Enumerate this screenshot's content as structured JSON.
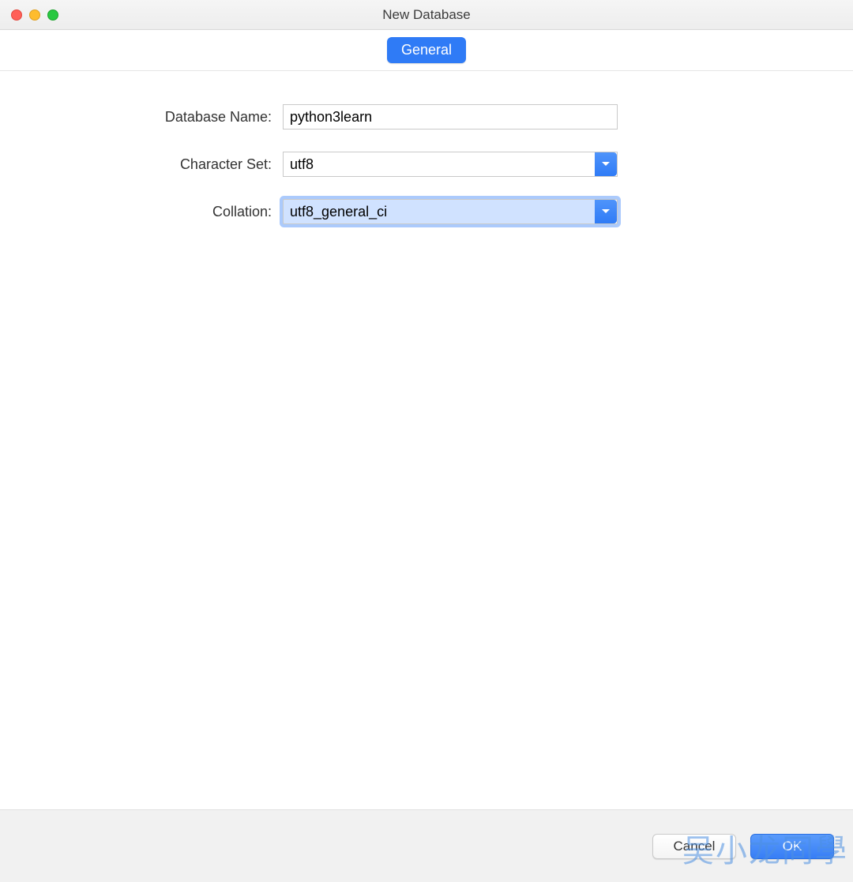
{
  "window": {
    "title": "New Database"
  },
  "tabs": {
    "general": "General"
  },
  "form": {
    "database_name": {
      "label": "Database Name:",
      "value": "python3learn"
    },
    "character_set": {
      "label": "Character Set:",
      "value": "utf8"
    },
    "collation": {
      "label": "Collation:",
      "value": "utf8_general_ci"
    }
  },
  "footer": {
    "cancel": "Cancel",
    "ok": "OK"
  },
  "watermark": "吴小龙同學"
}
